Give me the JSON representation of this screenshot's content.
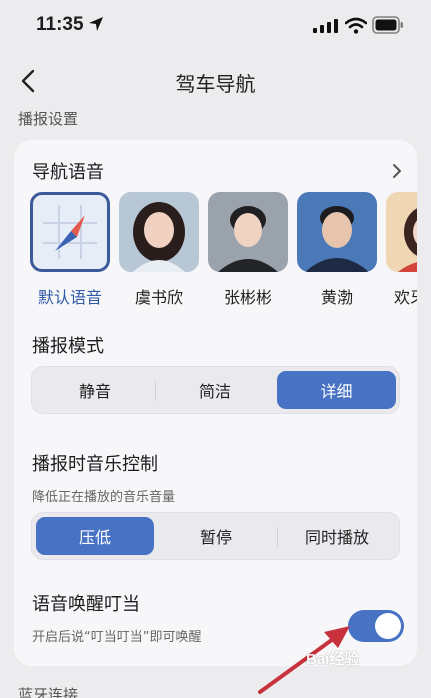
{
  "status_bar": {
    "time": "11:35",
    "location_icon": "location-arrow-icon",
    "signal_icon": "cell-signal-icon",
    "wifi_icon": "wifi-icon",
    "battery_icon": "battery-icon"
  },
  "nav": {
    "back_icon": "chevron-left-icon",
    "title": "驾车导航"
  },
  "section_broadcast": "播报设置",
  "nav_voice": {
    "title": "导航语音",
    "more_icon": "chevron-right-icon",
    "voices": [
      {
        "name": "默认语音",
        "selected": true,
        "icon": "compass-icon"
      },
      {
        "name": "虞书欣",
        "selected": false
      },
      {
        "name": "张彬彬",
        "selected": false
      },
      {
        "name": "黄渤",
        "selected": false
      },
      {
        "name": "欢牙妹",
        "selected": false
      }
    ]
  },
  "broadcast_mode": {
    "title": "播报模式",
    "options": [
      "静音",
      "简洁",
      "详细"
    ],
    "selected": "详细"
  },
  "music_control": {
    "title": "播报时音乐控制",
    "subtitle": "降低正在播放的音乐音量",
    "options": [
      "压低",
      "暂停",
      "同时播放"
    ],
    "selected": "压低"
  },
  "wake_word": {
    "title": "语音唤醒叮当",
    "subtitle": "开启后说“叮当叮当”即可唤醒",
    "enabled": true
  },
  "next_section": "蓝牙连接",
  "watermark": "Bai经验",
  "colors": {
    "accent": "#4872c4",
    "background": "#ececee",
    "card": "#f7f7f9",
    "arrow": "#c8323c"
  }
}
